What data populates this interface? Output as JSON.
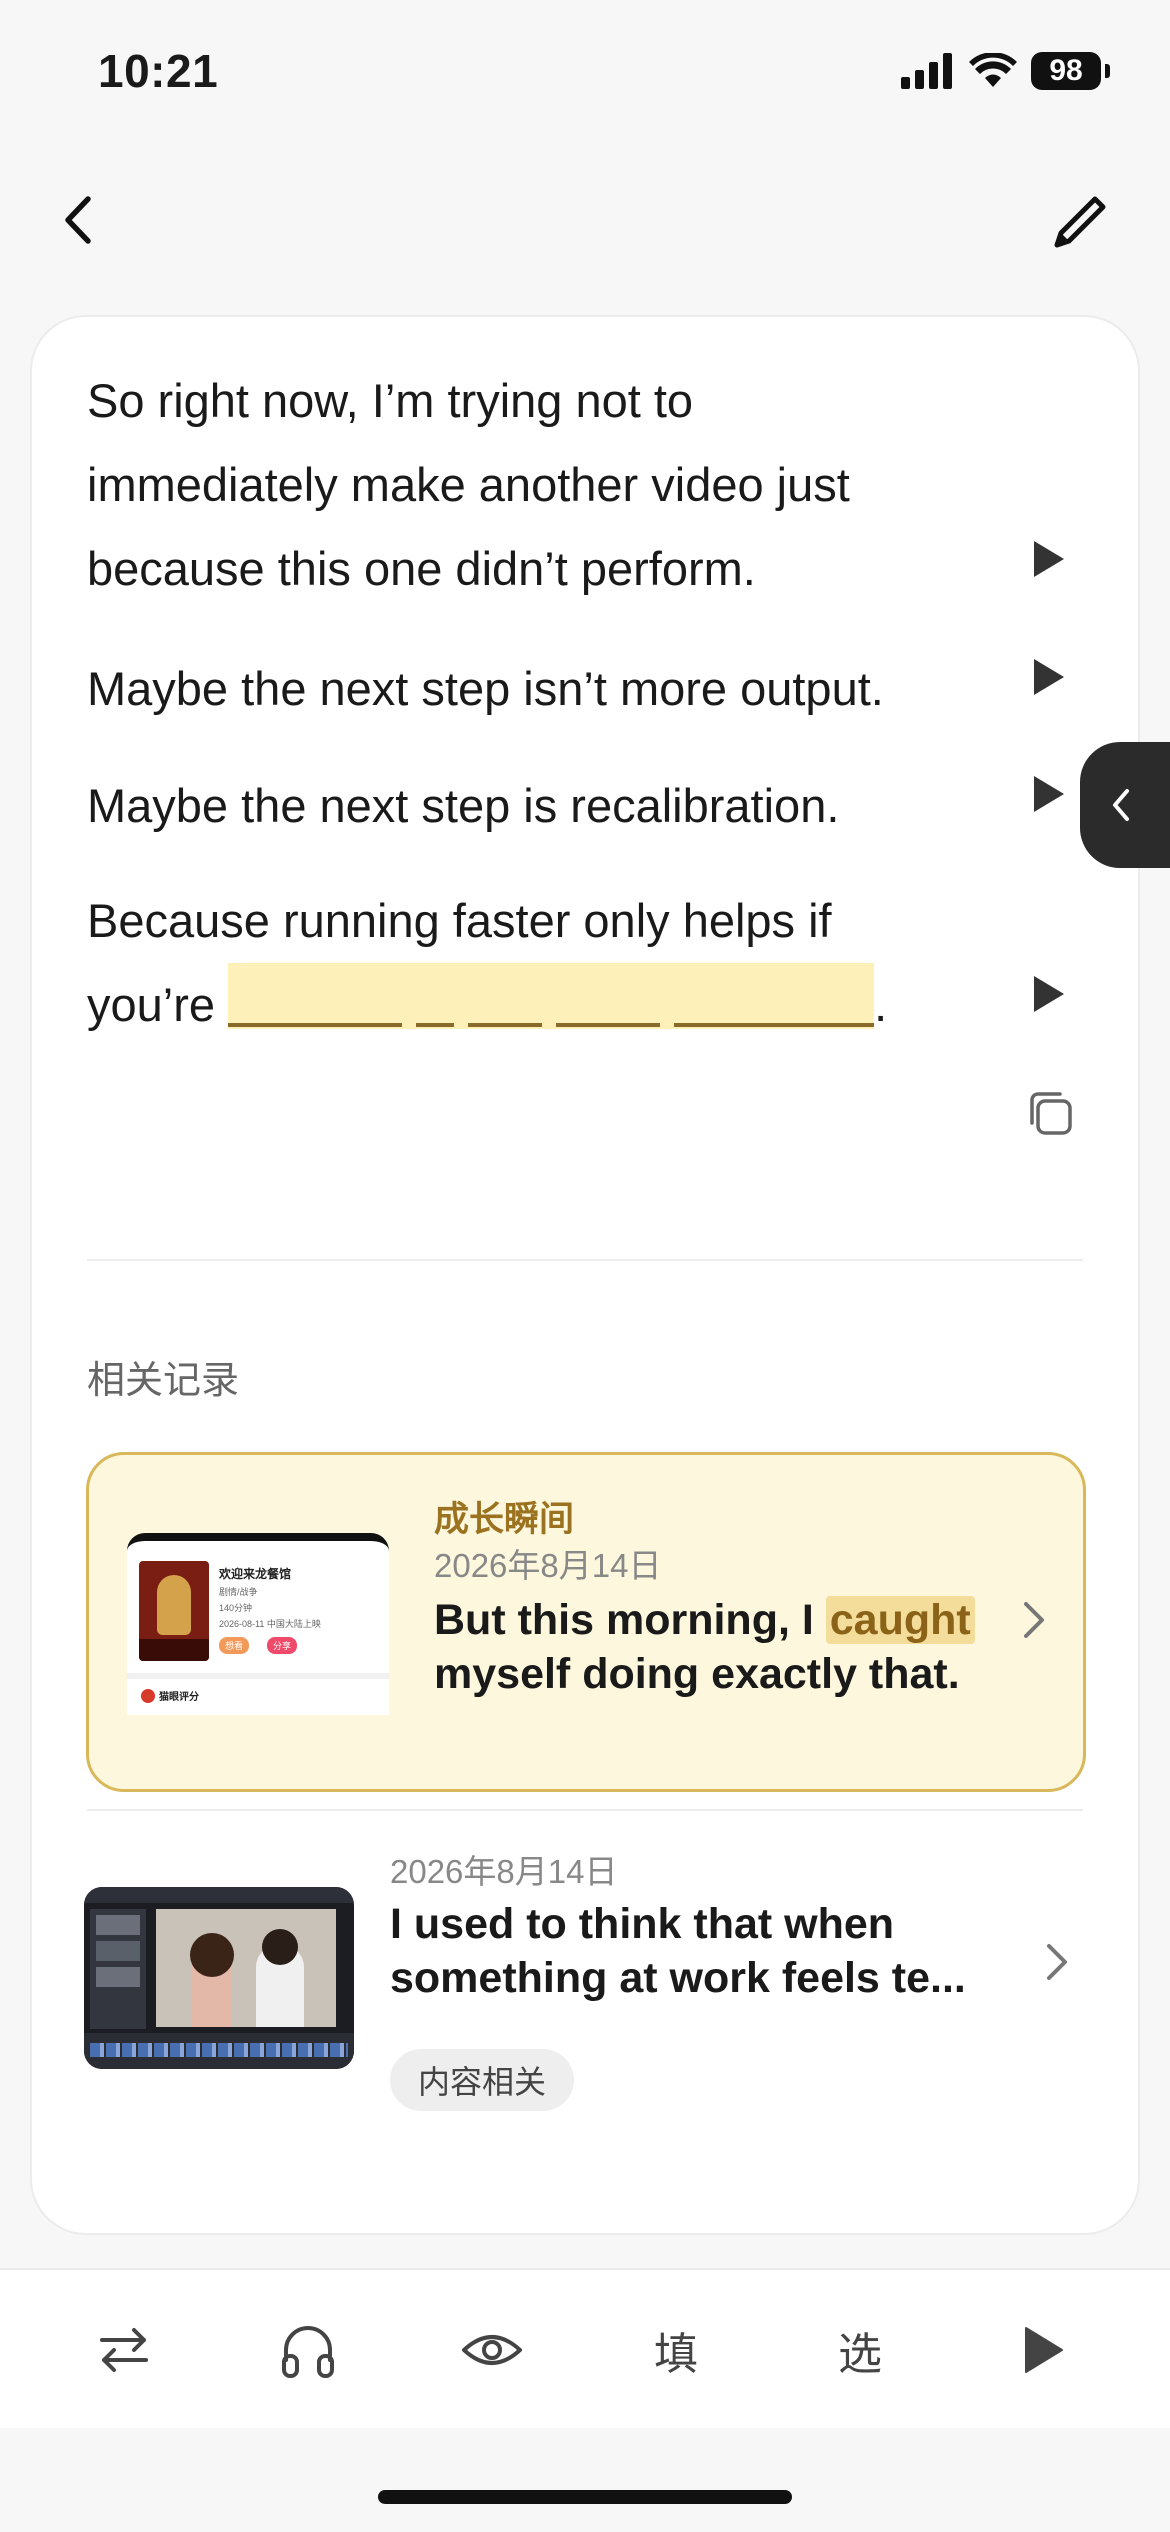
{
  "status_bar": {
    "time": "10:21",
    "battery": "98"
  },
  "sentences": [
    {
      "lines": [
        "So right now, I’m trying not to",
        "immediately make another video just",
        "because this one didn’t perform."
      ]
    },
    {
      "lines": [
        "Maybe the next step isn’t more output."
      ]
    },
    {
      "lines": [
        "Maybe the next step is recalibration."
      ]
    },
    {
      "line1": "Because running faster only helps if",
      "line2_prefix": "you’re",
      "line2_suffix": "."
    }
  ],
  "related": {
    "title": "相关记录",
    "records": [
      {
        "tag": "成长瞬间",
        "date": "2026年8月14日",
        "text_before": "But this morning, I ",
        "highlight": "caught",
        "text_after": " myself doing exactly that.",
        "thumb": {
          "title": "欢迎来龙餐馆",
          "line1": "剧情/战争",
          "line2": "140分钟",
          "line3": "2026-08-11 中国大陆上映",
          "btn1": "想看",
          "btn2": "分享",
          "rating": "猫眼评分"
        }
      },
      {
        "date": "2026年8月14日",
        "text": "I used to think that when something at work feels te...",
        "pill": "内容相关"
      }
    ]
  },
  "toolbar": {
    "fill_label": "填",
    "choose_label": "选"
  },
  "colors": {
    "highlight_bg": "#fdf0b8",
    "accent_gold": "#9b7320",
    "card_yellow": "#fdf7dd"
  }
}
